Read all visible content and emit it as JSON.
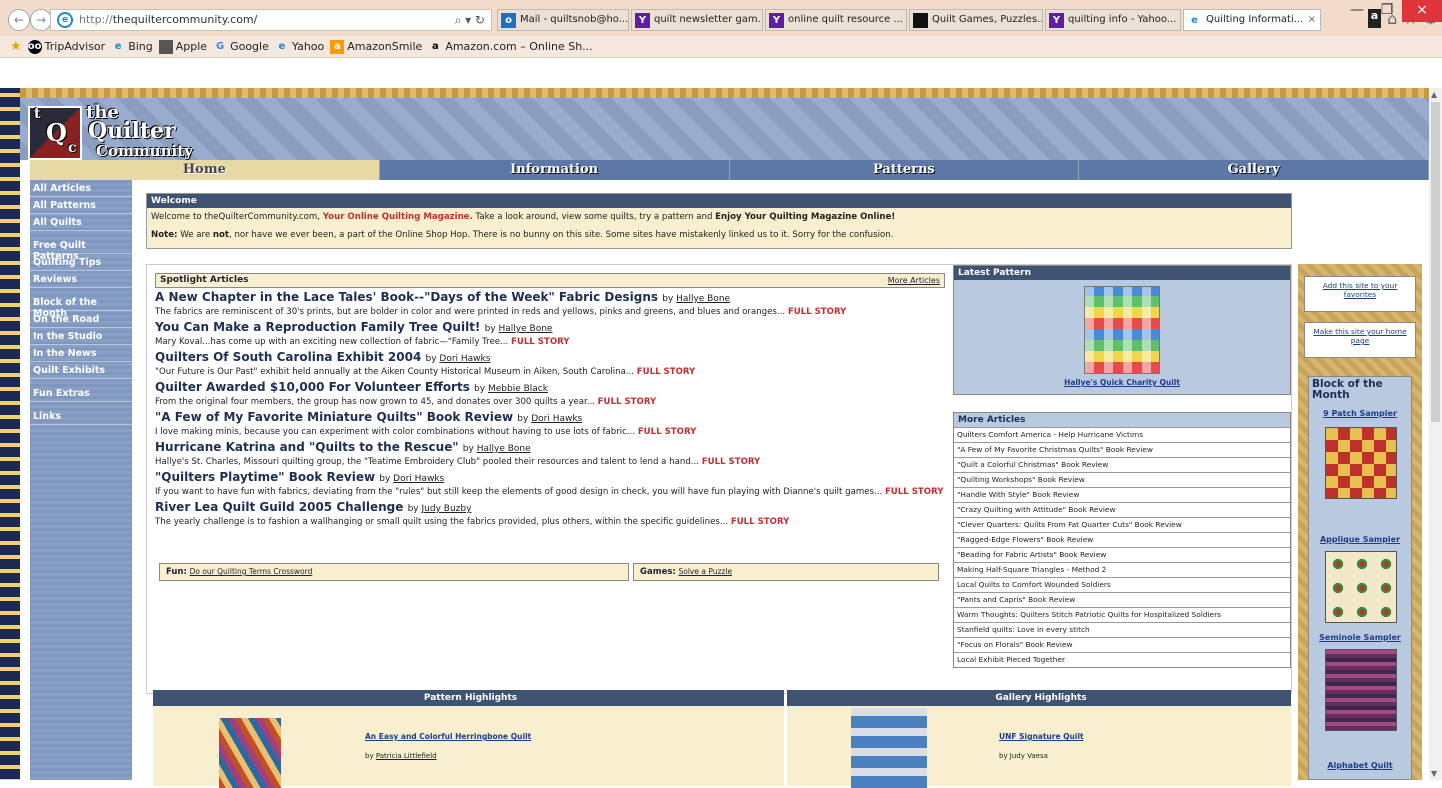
{
  "browser": {
    "url_proto": "http://",
    "url_host": "thequiltercommunity.com/",
    "search_icon": "search-icon",
    "tabs": [
      {
        "label": "Mail - quiltsnob@ho...",
        "icon": "outlook-icon"
      },
      {
        "label": "quilt newsletter gam...",
        "icon": "yahoo-icon"
      },
      {
        "label": "online quilt resource ...",
        "icon": "yahoo-icon"
      },
      {
        "label": "Quilt Games, Puzzles...",
        "icon": "page-icon"
      },
      {
        "label": "quilting info - Yahoo...",
        "icon": "yahoo-icon"
      },
      {
        "label": "Quilting Informati...",
        "icon": "ie-icon"
      }
    ],
    "favorites": [
      "TripAdvisor",
      "Bing",
      "Apple",
      "Google",
      "Yahoo",
      "AmazonSmile",
      "Amazon.com – Online Sh..."
    ]
  },
  "site": {
    "logo": {
      "the": "the",
      "quilter": "Quilter",
      "community": "Community",
      "letters": [
        "t",
        "Q",
        "c"
      ]
    },
    "menu": [
      "Home",
      "Information",
      "Patterns",
      "Gallery"
    ],
    "sidebar_groups": [
      [
        "All Articles",
        "All Patterns",
        "All Quilts"
      ],
      [
        "Free Quilt Patterns",
        "Quilting Tips",
        "Reviews"
      ],
      [
        "Block of the Month",
        "On the Road",
        "In the Studio",
        "In the News",
        "Quilt Exhibits"
      ],
      [
        "Fun Extras"
      ],
      [
        "Links"
      ]
    ]
  },
  "welcome": {
    "title": "Welcome",
    "line1_a": "Welcome to theQuilterCommunity.com, ",
    "line1_b": "Your Online Quilting Magazine.",
    "line1_c": " Take a look around, view some quilts, try a pattern and ",
    "line1_d": "Enjoy Your Quilting Magazine Online!",
    "line2_a": "Note:",
    "line2_b": " We are ",
    "line2_c": "not",
    "line2_d": ", nor have we ever been, a part of the Online Shop Hop. There is no bunny on this site. Some sites have mistakenly linked us to it. Sorry for the confusion."
  },
  "spotlight": {
    "title": "Spotlight Articles",
    "more": "More Articles",
    "full_story": "FULL STORY",
    "articles": [
      {
        "title": "A New Chapter in the Lace Tales' Book--\"Days of the Week\" Fabric Designs",
        "by": "by",
        "author": "Hallye Bone",
        "desc": "The fabrics are reminiscent of 30's prints, but are bolder in color and were printed in reds and yellows, pinks and greens, and blues and oranges..."
      },
      {
        "title": "You Can Make a Reproduction Family Tree Quilt!",
        "by": "by",
        "author": "Hallye Bone",
        "desc": "Mary Koval...has come up with an exciting new collection of fabric—\"Family Tree..."
      },
      {
        "title": "Quilters Of South Carolina Exhibit 2004",
        "by": "by",
        "author": "Dori Hawks",
        "desc": "\"Our Future is Our Past\" exhibit held annually at the Aiken County Historical Museum in Aiken, South Carolina..."
      },
      {
        "title": "Quilter Awarded $10,000 For Volunteer Efforts",
        "by": "by",
        "author": "Mebbie Black",
        "desc": "From the original four members, the group has now grown to 45, and donates over 300 quilts a year..."
      },
      {
        "title": "\"A Few of My Favorite Miniature Quilts\" Book Review",
        "by": "by",
        "author": "Dori Hawks",
        "desc": "I love making minis, because you can experiment with color combinations without having to use lots of fabric..."
      },
      {
        "title": "Hurricane Katrina and \"Quilts to the Rescue\"",
        "by": "by",
        "author": "Hallye Bone",
        "desc": "Hallye's St. Charles, Missouri quilting group, the \"Teatime Embroidery Club\" pooled their resources and talent to lend a hand..."
      },
      {
        "title": "\"Quilters Playtime\" Book Review",
        "by": "by",
        "author": "Dori Hawks",
        "desc": "If you want to have fun with fabrics, deviating from the \"rules\" but still keep the elements of good design in check, you will have fun playing with Dianne's quilt games..."
      },
      {
        "title": "River Lea Quilt Guild 2005 Challenge",
        "by": "by",
        "author": "Judy Buzby",
        "desc": "The yearly challenge is to fashion a wallhanging or small quilt using the fabrics provided, plus others, within the specific guidelines..."
      }
    ],
    "fun_label": "Fun:",
    "fun_link": "Do our Quilting Terms Crossword",
    "games_label": "Games:",
    "games_link": "Solve a Puzzle"
  },
  "latest_pattern": {
    "title": "Latest Pattern",
    "caption": "Hallye's Quick Charity Quilt"
  },
  "more_articles": {
    "title": "More Articles",
    "items": [
      "Quilters Comfort America - Help Hurricane Victims",
      "\"A Few of My Favorite Christmas Quilts\" Book Review",
      "\"Quilt a Colorful Christmas\" Book Review",
      "\"Quilting Workshops\" Book Review",
      "\"Handle With Style\" Book Review",
      "\"Crazy Quilting with Attitude\" Book Review",
      "\"Clever Quarters: Quilts From Fat Quarter Cuts\" Book Review",
      "\"Ragged-Edge Flowers\" Book Review",
      "\"Beading for Fabric Artists\" Book Review",
      "Making Half-Square Triangles - Method 2",
      "Local Quilts to Comfort Wounded Soldiers",
      "\"Pants and Capris\" Book Review",
      "Warm Thoughts: Quilters Stitch Patriotic Quilts for Hospitalized Soldiers",
      "Stanfield quilts: Love in every stitch",
      "\"Focus on Florals\" Book Review",
      "Local Exhibit Pieced Together"
    ]
  },
  "highlights": {
    "pattern_title": "Pattern Highlights",
    "pattern_link": "An Easy and Colorful Herringbone Quilt",
    "pattern_by": "by",
    "pattern_author": "Patricia Littlefield",
    "gallery_title": "Gallery Highlights",
    "gallery_link": "UNF Signature Quilt",
    "gallery_by": "by Judy Vaesa"
  },
  "rightcol": {
    "add_site": "Add this site to your favorites",
    "make_home": "Make this site your home page",
    "bom_title": "Block of the Month",
    "blocks": [
      "9 Patch Sampler",
      "Applique Sampler",
      "Seminole Sampler",
      "Alphabet Quilt"
    ]
  }
}
